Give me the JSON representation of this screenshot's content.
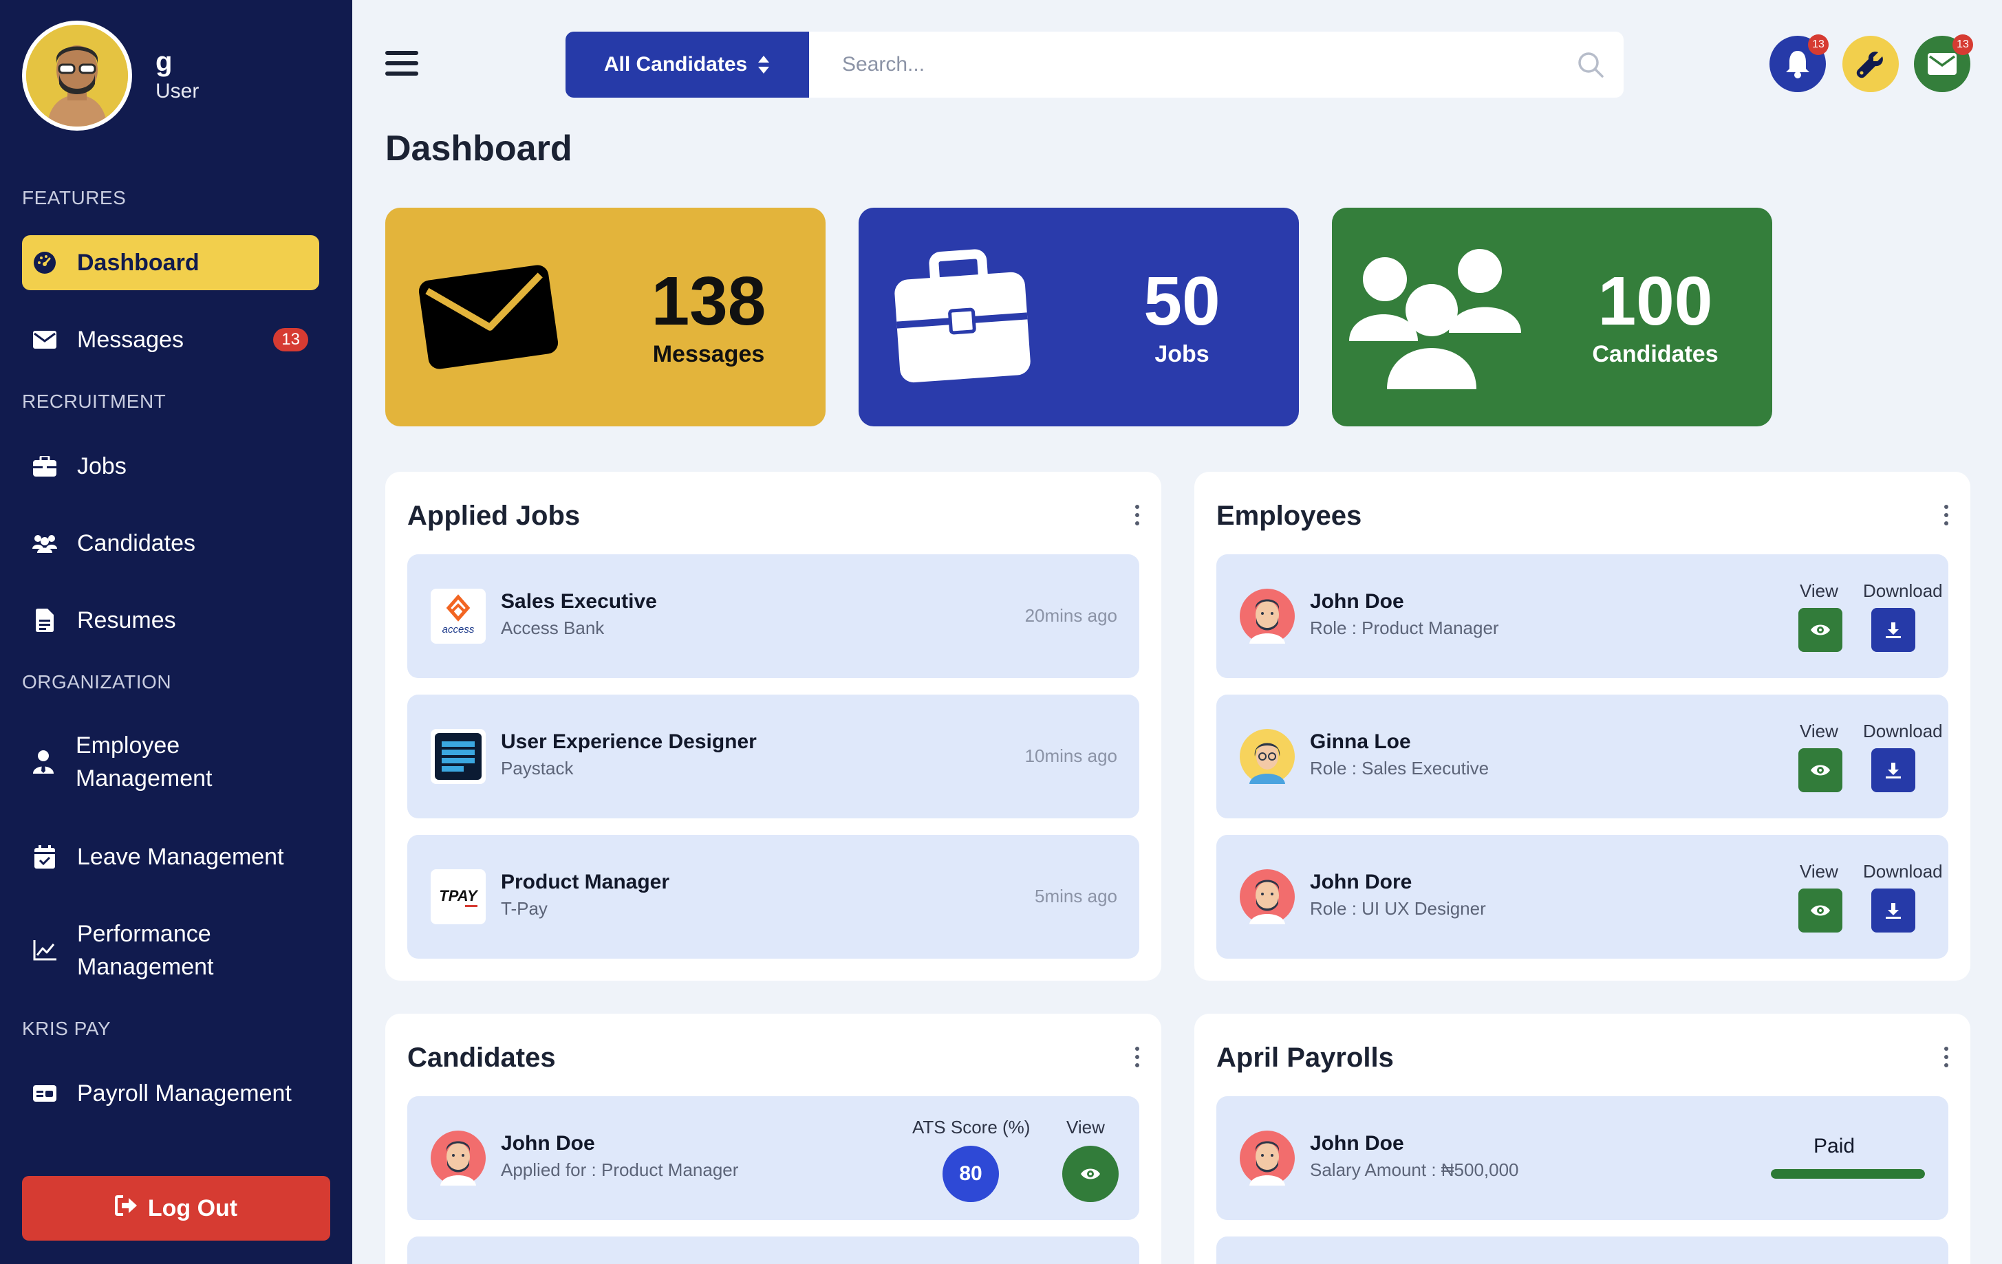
{
  "user": {
    "name": "g",
    "role": "User"
  },
  "sidebar": {
    "sections": {
      "features": "FEATURES",
      "recruitment": "RECRUITMENT",
      "organization": "ORGANIZATION",
      "kris_pay": "KRIS PAY"
    },
    "items": {
      "dashboard": "Dashboard",
      "messages": "Messages",
      "messages_badge": "13",
      "jobs": "Jobs",
      "candidates": "Candidates",
      "resumes": "Resumes",
      "employee_mgmt_1": "Employee",
      "employee_mgmt_2": "Management",
      "leave_mgmt": "Leave Management",
      "performance_mgmt_1": "Performance",
      "performance_mgmt_2": "Management",
      "payroll_mgmt": "Payroll Management"
    },
    "logout": "Log Out"
  },
  "search": {
    "select_label": "All Candidates",
    "placeholder": "Search..."
  },
  "top_icons": {
    "notifications_badge": "13",
    "mail_badge": "13"
  },
  "page_title": "Dashboard",
  "stats": [
    {
      "value": "138",
      "label": "Messages",
      "color": "#e3b43b"
    },
    {
      "value": "50",
      "label": "Jobs",
      "color": "#2a3bab"
    },
    {
      "value": "100",
      "label": "Candidates",
      "color": "#347e3b"
    }
  ],
  "applied_jobs": {
    "title": "Applied Jobs",
    "rows": [
      {
        "title": "Sales Executive",
        "company": "Access Bank",
        "time": "20mins ago",
        "logo": "access-bank-logo",
        "logo_text": "access"
      },
      {
        "title": "User Experience Designer",
        "company": "Paystack",
        "time": "10mins ago",
        "logo": "paystack-logo"
      },
      {
        "title": "Product Manager",
        "company": "T-Pay",
        "time": "5mins ago",
        "logo": "tpay-logo",
        "logo_text": "TPAY"
      }
    ]
  },
  "employees": {
    "title": "Employees",
    "view_label": "View",
    "download_label": "Download",
    "rows": [
      {
        "name": "John Doe",
        "role": "Role : Product Manager"
      },
      {
        "name": "Ginna Loe",
        "role": "Role : Sales Executive"
      },
      {
        "name": "John Dore",
        "role": "Role : UI UX Designer"
      }
    ]
  },
  "candidates": {
    "title": "Candidates",
    "ats_label": "ATS Score (%)",
    "view_label": "View",
    "rows": [
      {
        "name": "John Doe",
        "applied": "Applied for : Product Manager",
        "ats": "80"
      }
    ]
  },
  "payrolls": {
    "title": "April Payrolls",
    "rows": [
      {
        "name": "John Doe",
        "salary": "Salary Amount : ₦500,000",
        "status": "Paid",
        "progress": 1.0
      }
    ]
  },
  "colors": {
    "sidebar_bg": "#111b4e",
    "accent_yellow": "#f2cf4c",
    "accent_blue": "#263aa8",
    "accent_green": "#327c3a",
    "danger_red": "#d63b32"
  }
}
